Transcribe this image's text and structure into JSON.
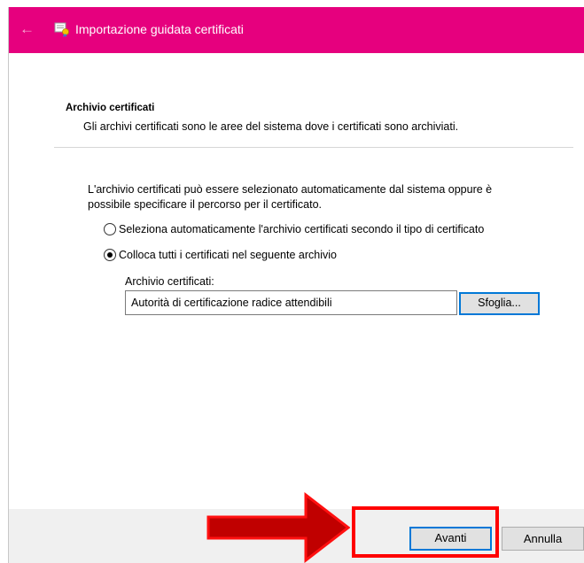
{
  "window": {
    "title": "Importazione guidata certificati",
    "title_bar_color": "#e6007e"
  },
  "header": {
    "title": "Archivio certificati",
    "description": "Gli archivi certificati sono le aree del sistema dove i certificati sono archiviati."
  },
  "body": {
    "intro": "L'archivio certificati può essere selezionato automaticamente dal sistema oppure è possibile specificare il percorso per il certificato.",
    "options": [
      {
        "label": "Seleziona automaticamente l'archivio certificati secondo il tipo di certificato",
        "checked": false
      },
      {
        "label": "Colloca tutti i certificati nel seguente archivio",
        "checked": true
      }
    ],
    "store_label": "Archivio certificati:",
    "store_value": "Autorità di certificazione radice attendibili",
    "browse_label": "Sfoglia..."
  },
  "footer": {
    "next_label": "Avanti",
    "cancel_label": "Annulla"
  },
  "annotation": {
    "highlight_color": "#ff0000",
    "arrow_color": "#c00000"
  },
  "icons": [
    "back-arrow-icon",
    "certificate-icon",
    "red-arrow-icon"
  ]
}
